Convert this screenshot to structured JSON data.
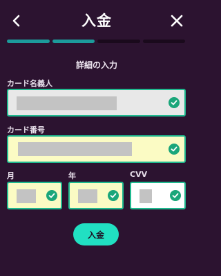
{
  "header": {
    "title": "入金"
  },
  "progress": {
    "total_steps": 4,
    "completed_steps": 2,
    "active_color": "#1c9b9b",
    "inactive_color": "#1a0a1c"
  },
  "form": {
    "section_title": "詳細の入力",
    "cardholder": {
      "label": "カード名義人",
      "value": ""
    },
    "card_number": {
      "label": "カード番号",
      "value": ""
    },
    "month": {
      "label": "月",
      "value": ""
    },
    "year": {
      "label": "年",
      "value": ""
    },
    "cvv": {
      "label": "CVV",
      "value": ""
    }
  },
  "submit": {
    "label": "入金"
  },
  "colors": {
    "background": "#2c1330",
    "valid_border": "#1fb98f",
    "check": "#1aa67a",
    "button": "#21e0c2"
  },
  "icons": [
    "back-icon",
    "close-icon",
    "check-circle-icon"
  ]
}
